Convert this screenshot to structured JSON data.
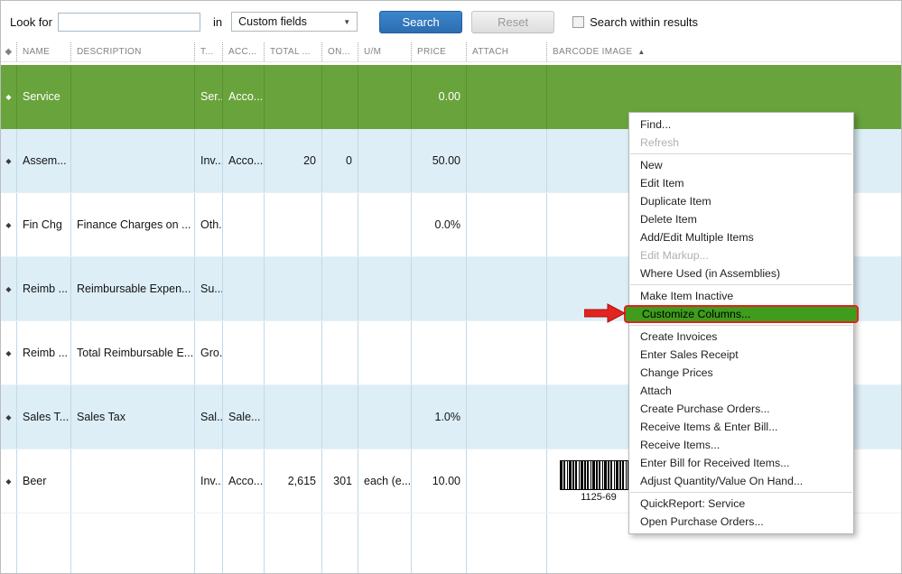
{
  "search": {
    "look_for_label": "Look for",
    "input_value": "",
    "in_label": "in",
    "field_select_value": "Custom fields",
    "search_button": "Search",
    "reset_button": "Reset",
    "within_results_label": "Search within results"
  },
  "table": {
    "columns": {
      "diamond": "◆",
      "name": "NAME",
      "description": "DESCRIPTION",
      "type": "T...",
      "account": "ACC...",
      "total": "TOTAL ...",
      "on": "ON...",
      "um": "U/M",
      "price": "PRICE",
      "attach": "ATTACH",
      "barcode": "BARCODE IMAGE",
      "sort_arrow": "▲"
    },
    "rows": [
      {
        "name": "Service",
        "description": "",
        "type": "Ser...",
        "account": "Acco...",
        "total": "",
        "on": "",
        "um": "",
        "price": "0.00"
      },
      {
        "name": "Assem...",
        "description": "",
        "type": "Inv...",
        "account": "Acco...",
        "total": "20",
        "on": "0",
        "um": "",
        "price": "50.00"
      },
      {
        "name": "Fin Chg",
        "description": "Finance Charges on ...",
        "type": "Oth...",
        "account": "",
        "total": "",
        "on": "",
        "um": "",
        "price": "0.0%"
      },
      {
        "name": "Reimb ...",
        "description": "Reimbursable Expen...",
        "type": "Su...",
        "account": "",
        "total": "",
        "on": "",
        "um": "",
        "price": ""
      },
      {
        "name": "Reimb ...",
        "description": "Total Reimbursable E...",
        "type": "Gro...",
        "account": "",
        "total": "",
        "on": "",
        "um": "",
        "price": ""
      },
      {
        "name": "Sales T...",
        "description": "Sales Tax",
        "type": "Sal...",
        "account": "Sale...",
        "total": "",
        "on": "",
        "um": "",
        "price": "1.0%"
      },
      {
        "name": "Beer",
        "description": "",
        "type": "Inv...",
        "account": "Acco...",
        "total": "2,615",
        "on": "301",
        "um": "each (e...",
        "price": "10.00",
        "barcode_label": "1125-69"
      }
    ]
  },
  "context_menu": {
    "groups": [
      {
        "items": [
          {
            "label": "Find...",
            "enabled": true
          },
          {
            "label": "Refresh",
            "enabled": false
          }
        ]
      },
      {
        "items": [
          {
            "label": "New",
            "enabled": true
          },
          {
            "label": "Edit Item",
            "enabled": true
          },
          {
            "label": "Duplicate Item",
            "enabled": true
          },
          {
            "label": "Delete Item",
            "enabled": true
          },
          {
            "label": "Add/Edit Multiple Items",
            "enabled": true
          },
          {
            "label": "Edit Markup...",
            "enabled": false
          },
          {
            "label": "Where Used (in Assemblies)",
            "enabled": true
          }
        ]
      },
      {
        "items": [
          {
            "label": "Make Item Inactive",
            "enabled": true
          },
          {
            "label": "Customize Columns...",
            "enabled": true,
            "highlighted": true
          }
        ]
      },
      {
        "items": [
          {
            "label": "Create Invoices",
            "enabled": true
          },
          {
            "label": "Enter Sales Receipt",
            "enabled": true
          },
          {
            "label": "Change Prices",
            "enabled": true
          },
          {
            "label": "Attach",
            "enabled": true
          },
          {
            "label": "Create Purchase Orders...",
            "enabled": true
          },
          {
            "label": "Receive Items & Enter Bill...",
            "enabled": true
          },
          {
            "label": "Receive Items...",
            "enabled": true
          },
          {
            "label": "Enter Bill for Received Items...",
            "enabled": true
          },
          {
            "label": "Adjust Quantity/Value On Hand...",
            "enabled": true
          }
        ]
      },
      {
        "items": [
          {
            "label": "QuickReport: Service",
            "enabled": true
          },
          {
            "label": "Open Purchase Orders...",
            "enabled": true
          }
        ]
      }
    ]
  },
  "colors": {
    "selected_row_green": "#69a33c",
    "alt_row_blue": "#ddeef7",
    "menu_highlight_green": "#3f9c1d",
    "highlight_border_red": "#e3231d",
    "arrow_red": "#e3231d",
    "search_button_blue": "#2d6db1"
  }
}
